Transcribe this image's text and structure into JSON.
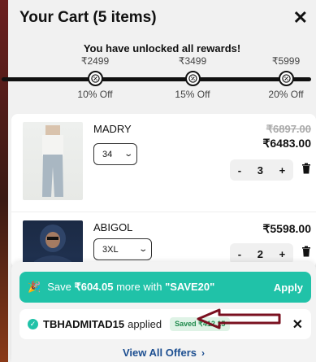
{
  "header": {
    "title": "Your Cart (5 items)",
    "close_icon": "close-icon"
  },
  "rewards": {
    "message": "You have unlocked all rewards!",
    "milestones": [
      {
        "price": "₹2499",
        "discount": "10% Off"
      },
      {
        "price": "₹3499",
        "discount": "15% Off"
      },
      {
        "price": "₹5999",
        "discount": "20% Off"
      }
    ],
    "progress_fraction": 1.0
  },
  "items": [
    {
      "name": "MADRY",
      "size": "34",
      "original_price": "₹6897.00",
      "price": "₹6483.00",
      "quantity": "3"
    },
    {
      "name": "ABIGOL",
      "size": "3XL",
      "price": "₹5598.00",
      "quantity": "2"
    }
  ],
  "qty_controls": {
    "minus": "-",
    "plus": "+"
  },
  "offer": {
    "text_prefix": "Save ",
    "amount": "₹604.05",
    "text_middle": " more with ",
    "code": "\"SAVE20\"",
    "apply_label": "Apply"
  },
  "coupon": {
    "code": "TBHADMITAD15",
    "status": "applied",
    "saved_label": "Saved ₹412.15"
  },
  "footer": {
    "view_all_offers": "View All Offers"
  },
  "colors": {
    "accent": "#20c2a8",
    "link": "#1d4f91",
    "annotation": "#7a1020"
  }
}
